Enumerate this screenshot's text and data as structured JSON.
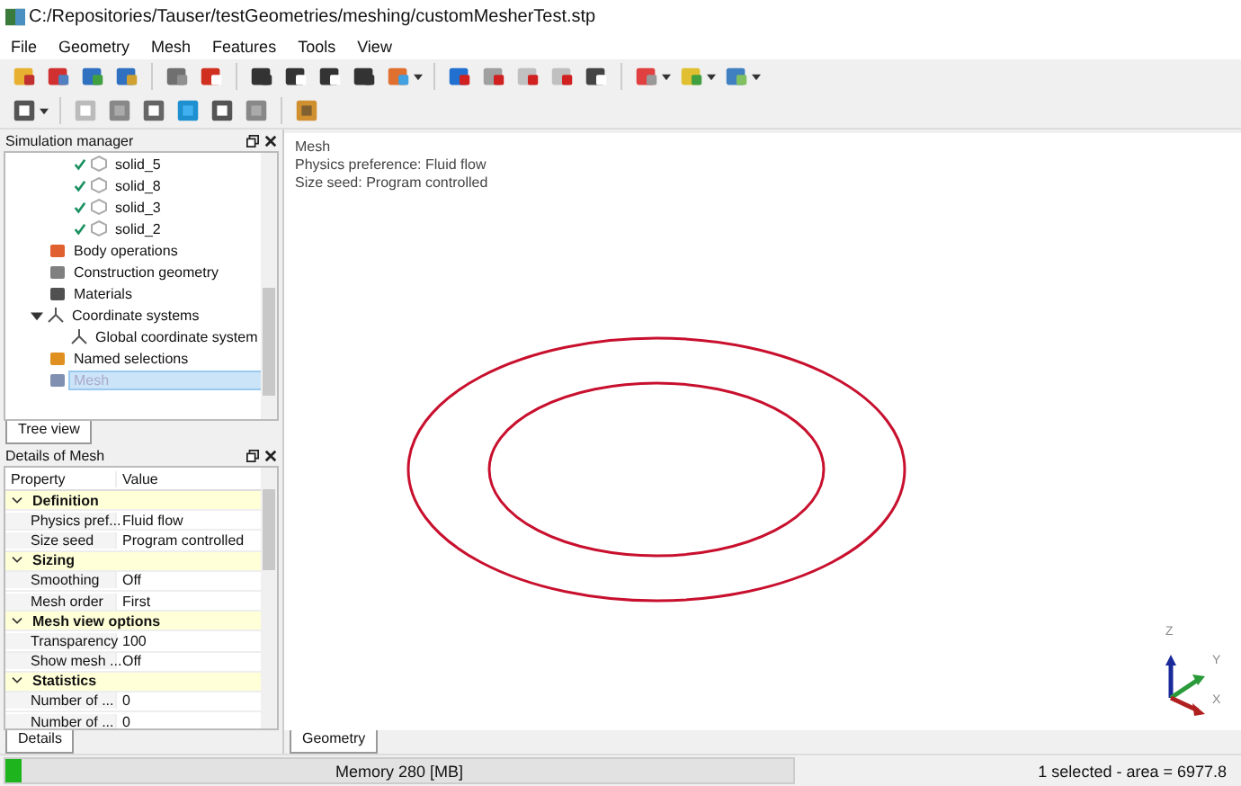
{
  "window": {
    "title": "C:/Repositories/Tauser/testGeometries/meshing/customMesherTest.stp"
  },
  "menu": [
    "File",
    "Geometry",
    "Mesh",
    "Features",
    "Tools",
    "View"
  ],
  "simulation_manager": {
    "title": "Simulation manager",
    "tree": {
      "partial_branch": [
        {
          "label": "solid_5",
          "checked": true
        },
        {
          "label": "solid_8",
          "checked": true
        },
        {
          "label": "solid_3",
          "checked": true
        },
        {
          "label": "solid_2",
          "checked": true
        }
      ],
      "items": [
        {
          "label": "Body operations",
          "kind": "bodyops",
          "selected": false
        },
        {
          "label": "Construction geometry",
          "kind": "construction",
          "selected": false
        },
        {
          "label": "Materials",
          "kind": "materials",
          "selected": false
        },
        {
          "label": "Coordinate systems",
          "kind": "coords",
          "selected": false,
          "expanded": true,
          "children": [
            {
              "label": "Global coordinate system",
              "kind": "coords",
              "selected": false
            }
          ]
        },
        {
          "label": "Named selections",
          "kind": "named",
          "selected": false
        },
        {
          "label": "Mesh",
          "kind": "mesh",
          "selected": true
        }
      ]
    },
    "tabs": [
      {
        "label": "Tree view",
        "selected": true
      }
    ]
  },
  "details": {
    "title": "Details of Mesh",
    "columns": [
      "Property",
      "Value"
    ],
    "groups": [
      {
        "label": "Definition",
        "expanded": true,
        "rows": [
          [
            "Physics pref...",
            "Fluid flow"
          ],
          [
            "Size seed",
            "Program controlled"
          ]
        ]
      },
      {
        "label": "Sizing",
        "expanded": true,
        "rows": [
          [
            "Smoothing",
            "Off"
          ],
          [
            "Mesh order",
            "First"
          ]
        ]
      },
      {
        "label": "Mesh view options",
        "expanded": true,
        "rows": [
          [
            "Transparency",
            "100"
          ],
          [
            "Show mesh ...",
            "Off"
          ]
        ]
      },
      {
        "label": "Statistics",
        "expanded": true,
        "rows": [
          [
            "Number of ...",
            "0"
          ],
          [
            "Number of ...",
            "0"
          ]
        ]
      }
    ],
    "tabs": [
      {
        "label": "Details",
        "selected": true
      }
    ]
  },
  "viewport": {
    "info": [
      "Mesh",
      "Physics preference: Fluid flow",
      "Size seed: Program controlled"
    ],
    "axes": [
      "Z",
      "Y",
      "X"
    ],
    "tabs": [
      {
        "label": "Geometry",
        "selected": true
      }
    ]
  },
  "status_bar": {
    "memory": {
      "label": "Memory 280 [MB]",
      "level": 0.02
    },
    "selection": "1 selected - area = 6977.8"
  }
}
